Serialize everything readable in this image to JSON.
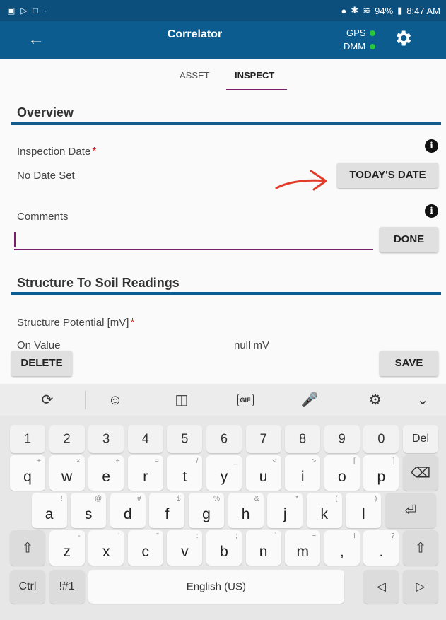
{
  "status_bar": {
    "battery": "94%",
    "time": "8:47 AM"
  },
  "app_bar": {
    "title": "Correlator",
    "gps_label": "GPS",
    "dmm_label": "DMM",
    "status_color": "#28c840"
  },
  "tabs": [
    {
      "label": "ASSET"
    },
    {
      "label": "INSPECT"
    }
  ],
  "overview": {
    "title": "Overview",
    "inspection_date_label": "Inspection Date",
    "required_mark": "*",
    "date_value": "No Date Set",
    "todays_date_button": "TODAY'S DATE",
    "comments_label": "Comments",
    "comments_value": "",
    "done_button": "DONE"
  },
  "soil_readings": {
    "title": "Structure To Soil Readings",
    "structure_potential_label": "Structure Potential [mV]",
    "required_mark": "*",
    "on_value_label": "On Value",
    "on_value": "null mV"
  },
  "footer": {
    "delete_button": "DELETE",
    "save_button": "SAVE"
  },
  "keyboard": {
    "toolbar_icons": [
      "translate-icon",
      "emoji-icon",
      "sticker-icon",
      "gif-icon",
      "mic-icon",
      "settings-icon",
      "collapse-icon"
    ],
    "gif_label": "GIF",
    "number_row": [
      "1",
      "2",
      "3",
      "4",
      "5",
      "6",
      "7",
      "8",
      "9",
      "0",
      "Del"
    ],
    "row1": [
      {
        "k": "q",
        "alt": "+"
      },
      {
        "k": "w",
        "alt": "×"
      },
      {
        "k": "e",
        "alt": "÷"
      },
      {
        "k": "r",
        "alt": "="
      },
      {
        "k": "t",
        "alt": "/"
      },
      {
        "k": "y",
        "alt": "_"
      },
      {
        "k": "u",
        "alt": "<"
      },
      {
        "k": "i",
        "alt": ">"
      },
      {
        "k": "o",
        "alt": "["
      },
      {
        "k": "p",
        "alt": "]"
      }
    ],
    "row2": [
      {
        "k": "a",
        "alt": "!"
      },
      {
        "k": "s",
        "alt": "@"
      },
      {
        "k": "d",
        "alt": "#"
      },
      {
        "k": "f",
        "alt": "$"
      },
      {
        "k": "g",
        "alt": "%"
      },
      {
        "k": "h",
        "alt": "&"
      },
      {
        "k": "j",
        "alt": "*"
      },
      {
        "k": "k",
        "alt": "("
      },
      {
        "k": "l",
        "alt": ")"
      }
    ],
    "row3": [
      {
        "k": "z",
        "alt": "-"
      },
      {
        "k": "x",
        "alt": "'"
      },
      {
        "k": "c",
        "alt": "\""
      },
      {
        "k": "v",
        "alt": ":"
      },
      {
        "k": "b",
        "alt": ";"
      },
      {
        "k": "n",
        "alt": "`"
      },
      {
        "k": "m",
        "alt": "~"
      },
      {
        "k": ",",
        "alt": "!"
      },
      {
        "k": ".",
        "alt": "?"
      }
    ],
    "ctrl_label": "Ctrl",
    "symbols_label": "!#1",
    "space_label": "English (US)"
  }
}
